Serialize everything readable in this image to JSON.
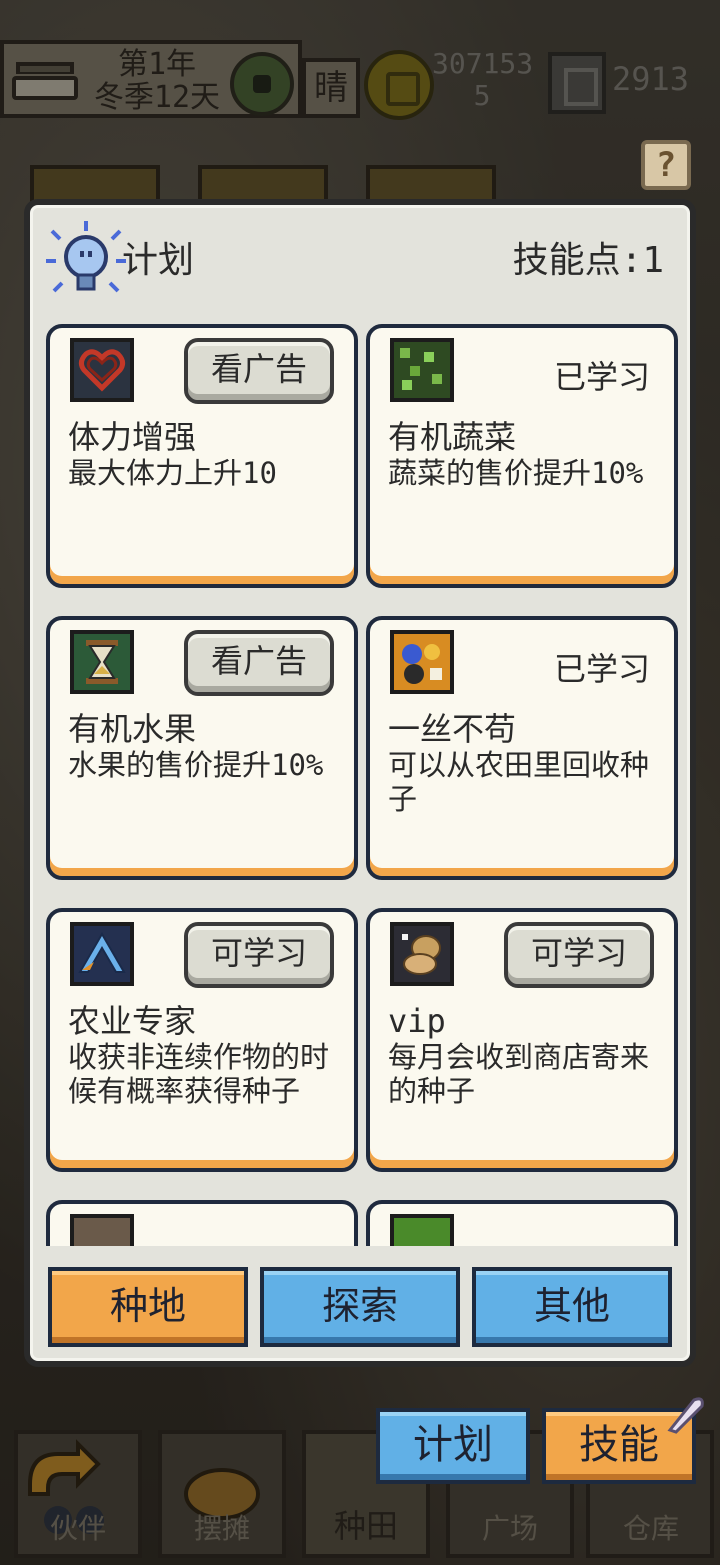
{
  "status_bar": {
    "date_line1": "第1年",
    "date_line2": "冬季12天",
    "weather": "晴",
    "gold_line1": "307153",
    "gold_line2": "5",
    "gems": "2913"
  },
  "panel": {
    "title": "计划",
    "skill_points": "技能点:1",
    "cards": [
      {
        "name": "体力增强",
        "desc": "最大体力上升10",
        "action": "看广告",
        "state": "button",
        "icon": "heart-icon",
        "icon_color": "#2b3340"
      },
      {
        "name": "有机蔬菜",
        "desc": "蔬菜的售价提升10%",
        "action": "已学习",
        "state": "learned",
        "icon": "vegetable-icon",
        "icon_color": "#2e4a22"
      },
      {
        "name": "有机水果",
        "desc": "水果的售价提升10%",
        "action": "看广告",
        "state": "button",
        "icon": "hourglass-icon",
        "icon_color": "#2c5a38"
      },
      {
        "name": "一丝不苟",
        "desc": "可以从农田里回收种子",
        "action": "已学习",
        "state": "learned",
        "icon": "seeds-icon",
        "icon_color": "#d88c22"
      },
      {
        "name": "农业专家",
        "desc": "收获非连续作物的时候有概率获得种子",
        "action": "可学习",
        "state": "button",
        "icon": "pickaxe-icon",
        "icon_color": "#243050"
      },
      {
        "name": "vip",
        "desc": "每月会收到商店寄来的种子",
        "action": "可学习",
        "state": "button",
        "icon": "seed-bag-icon",
        "icon_color": "#2c2c34"
      }
    ],
    "tabs": [
      {
        "label": "种地",
        "active": true
      },
      {
        "label": "探索",
        "active": false
      },
      {
        "label": "其他",
        "active": false
      }
    ]
  },
  "actions": {
    "plan_label": "计划",
    "skill_label": "技能"
  },
  "bottom_nav": [
    {
      "label": "伙伴",
      "icon": "partner-icon"
    },
    {
      "label": "摆摊",
      "icon": "stall-icon"
    },
    {
      "label": "种田",
      "icon": "farm-icon"
    },
    {
      "label": "广场",
      "icon": "plaza-icon"
    },
    {
      "label": "仓库",
      "icon": "warehouse-icon"
    }
  ],
  "colors": {
    "accent_orange": "#f2a64a",
    "accent_blue": "#61b0e6",
    "panel_bg": "#e3e3dc",
    "card_bg": "#fbf9ef"
  }
}
